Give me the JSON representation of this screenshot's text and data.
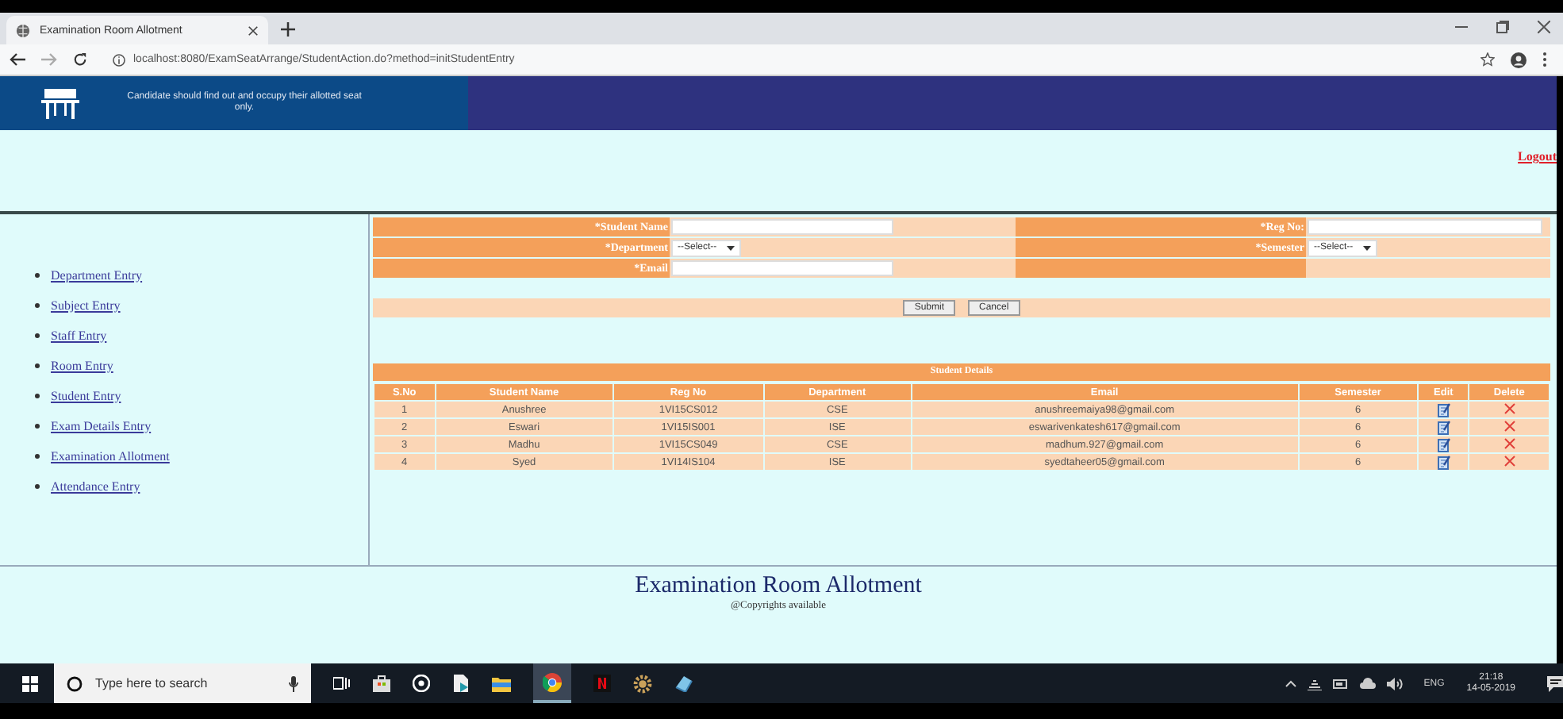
{
  "browser": {
    "tab_title": "Examination Room Allotment",
    "url": "localhost:8080/ExamSeatArrange/StudentAction.do?method=initStudentEntry"
  },
  "header": {
    "notice": "Candidate should find out and occupy their allotted seat only."
  },
  "logout": "Logout",
  "sidebar": {
    "items": [
      "Department Entry",
      "Subject Entry",
      "Staff Entry",
      "Room Entry",
      "Student Entry",
      "Exam Details Entry",
      "Examination Allotment",
      "Attendance Entry"
    ]
  },
  "form": {
    "rows": [
      [
        {
          "label": "*Student Name",
          "kind": "text"
        },
        {
          "label": "*Reg No:",
          "kind": "text"
        }
      ],
      [
        {
          "label": "*Department",
          "kind": "select",
          "value": "--Select--"
        },
        {
          "label": "*Semester",
          "kind": "select",
          "value": "--Select--"
        }
      ],
      [
        {
          "label": "*Email",
          "kind": "text"
        }
      ]
    ],
    "buttons": [
      "Submit",
      "Cancel"
    ]
  },
  "table": {
    "title": "Student Details",
    "columns": [
      "S.No",
      "Student Name",
      "Reg No",
      "Department",
      "Email",
      "Semester",
      "Edit",
      "Delete"
    ],
    "rows": [
      {
        "cells": [
          "1",
          "Anushree",
          "1VI15CS012",
          "CSE",
          "anushreemaiya98@gmail.com",
          "6"
        ]
      },
      {
        "cells": [
          "2",
          "Eswari",
          "1VI15IS001",
          "ISE",
          "eswarivenkatesh617@gmail.com",
          "6"
        ]
      },
      {
        "cells": [
          "3",
          "Madhu",
          "1VI15CS049",
          "CSE",
          "madhum.927@gmail.com",
          "6"
        ]
      },
      {
        "cells": [
          "4",
          "Syed",
          "1VI14IS104",
          "ISE",
          "syedtaheer05@gmail.com",
          "6"
        ]
      }
    ]
  },
  "footer": {
    "title": "Examination Room Allotment",
    "copyright": "@Copyrights available"
  },
  "taskbar": {
    "search_placeholder": "Type here to search",
    "language": "ENG",
    "time": "21:18",
    "date": "14-05-2019"
  }
}
